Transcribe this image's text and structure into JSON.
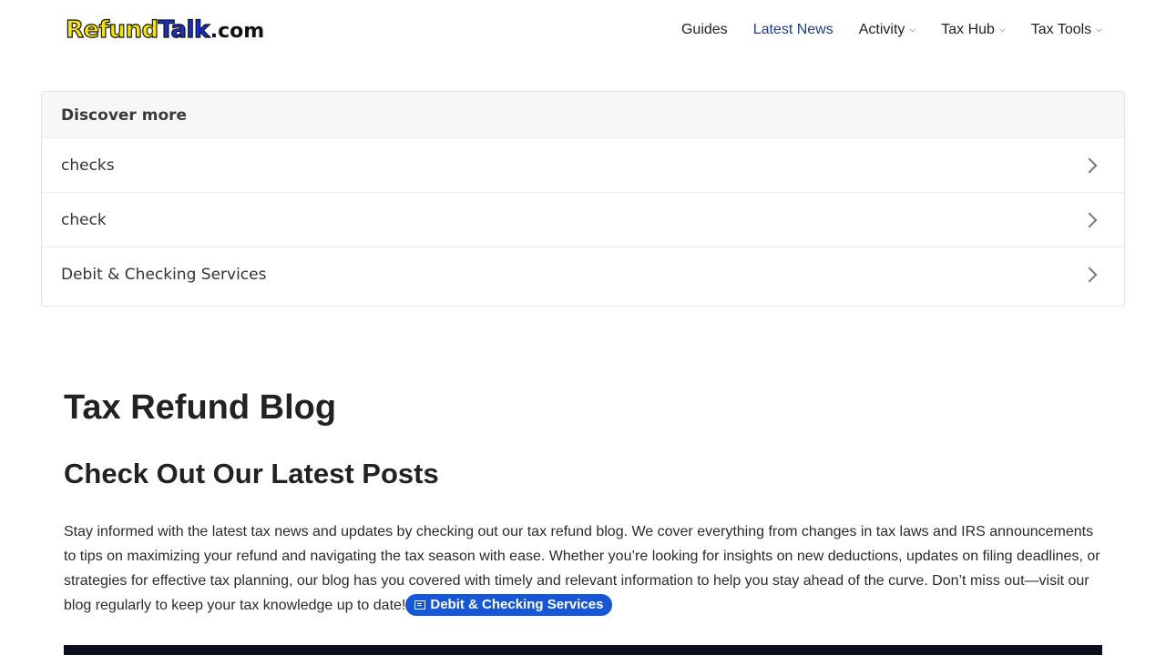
{
  "logo": {
    "part1": "Refund",
    "part2": "Talk",
    "part3": ".com"
  },
  "nav": [
    {
      "label": "Guides",
      "dropdown": false
    },
    {
      "label": "Latest News",
      "dropdown": false
    },
    {
      "label": "Activity",
      "dropdown": true
    },
    {
      "label": "Tax Hub",
      "dropdown": true
    },
    {
      "label": "Tax Tools",
      "dropdown": true
    }
  ],
  "discover": {
    "heading": "Discover more",
    "items": [
      {
        "label": "checks",
        "icon": "chevron-right-icon"
      },
      {
        "label": "check",
        "icon": "chevron-right-icon"
      },
      {
        "label": "Debit & Checking Services",
        "icon": "chevron-right-icon"
      }
    ]
  },
  "main": {
    "title": "Tax Refund Blog",
    "subtitle": "Check Out Our Latest Posts",
    "paragraph": "Stay informed with the latest tax news and updates by checking out our tax refund blog. We cover everything from changes in tax laws and IRS announcements to tips on maximizing your refund and navigating the tax season with ease. Whether you’re looking for insights on new deductions, updates on filing deadlines, or strategies for effective tax planning, our blog has you covered with timely and relevant information to help you stay ahead of the curve. Don’t miss out—visit our blog regularly to keep your tax knowledge up to date!",
    "pill_label": "Debit & Checking Services"
  },
  "colors": {
    "accent": "#1557d6",
    "nav_active": "#1f3d8a",
    "logo_yellow": "#f5e600",
    "logo_blue": "#1a2fcf"
  }
}
